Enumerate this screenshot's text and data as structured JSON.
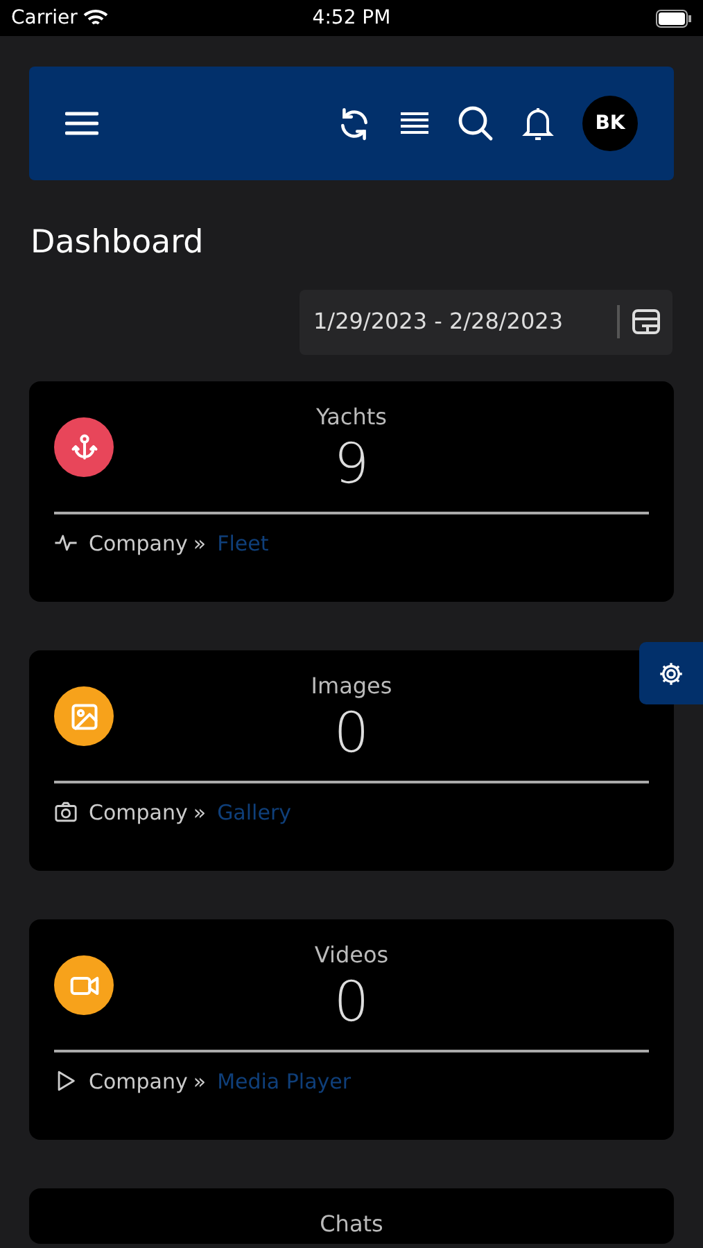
{
  "status_bar": {
    "carrier": "Carrier",
    "time": "4:52 PM"
  },
  "header": {
    "avatar": "BK"
  },
  "page_title": "Dashboard",
  "date_range": {
    "value": "1/29/2023 - 2/28/2023"
  },
  "cards": [
    {
      "kind": "anchor",
      "color": "#e8465a",
      "title": "Yachts",
      "value": "9",
      "footer": {
        "kind": "pulse",
        "label": "Company",
        "separator": "»",
        "link": "Fleet"
      }
    },
    {
      "kind": "image",
      "color": "#f7a21b",
      "title": "Images",
      "value": "0",
      "footer": {
        "kind": "camera",
        "label": "Company",
        "separator": "»",
        "link": "Gallery"
      }
    },
    {
      "kind": "video",
      "color": "#f7a21b",
      "title": "Videos",
      "value": "0",
      "footer": {
        "kind": "play",
        "label": "Company",
        "separator": "»",
        "link": "Media Player"
      }
    },
    {
      "kind": "chat",
      "title": "Chats"
    }
  ]
}
